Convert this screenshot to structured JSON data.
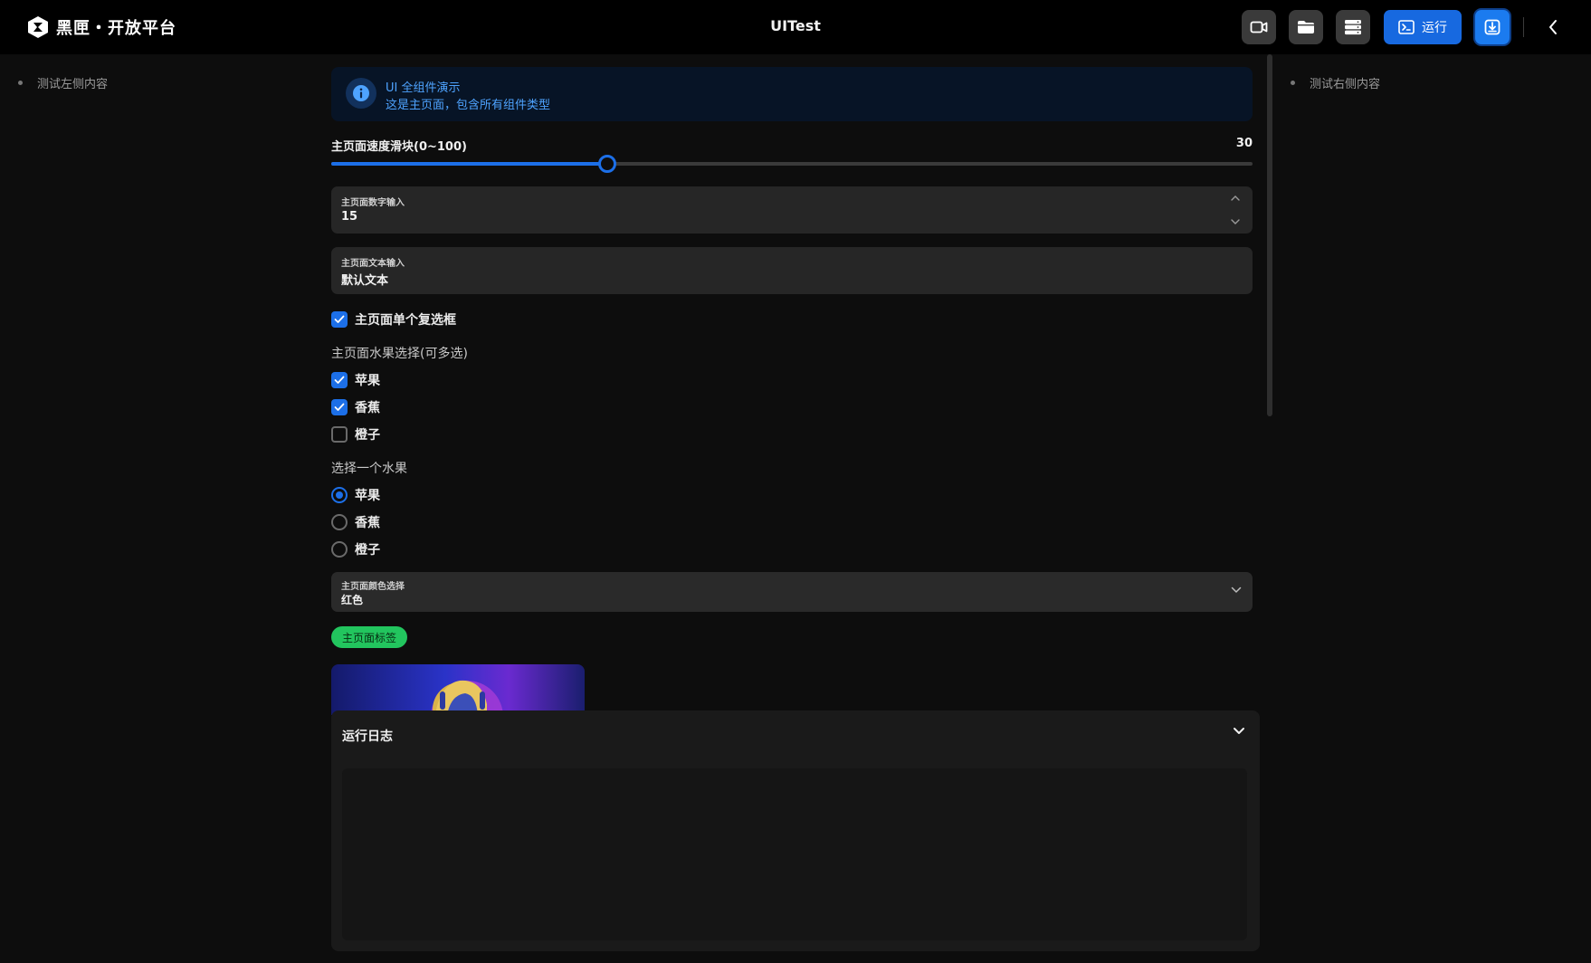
{
  "app": {
    "brand": "黑匣・开放平台",
    "title": "UITest"
  },
  "toolbar": {
    "run_label": "运行"
  },
  "left_panel": {
    "item": "测试左侧内容"
  },
  "right_panel": {
    "item": "测试右侧内容"
  },
  "alert": {
    "title": "UI 全组件演示",
    "description": "这是主页面，包含所有组件类型"
  },
  "slider": {
    "label": "主页面速度滑块(0~100)",
    "value": "30",
    "fraction": 0.3
  },
  "number_input": {
    "label": "主页面数字输入",
    "value": "15"
  },
  "text_input": {
    "label": "主页面文本输入",
    "value": "默认文本"
  },
  "single_checkbox": {
    "label": "主页面单个复选框",
    "checked": true
  },
  "fruit_checkboxes": {
    "title": "主页面水果选择(可多选)",
    "options": [
      {
        "label": "苹果",
        "checked": true
      },
      {
        "label": "香蕉",
        "checked": true
      },
      {
        "label": "橙子",
        "checked": false
      }
    ]
  },
  "fruit_radio": {
    "title": "选择一个水果",
    "options": [
      {
        "label": "苹果",
        "selected": true
      },
      {
        "label": "香蕉",
        "selected": false
      },
      {
        "label": "橙子",
        "selected": false
      }
    ]
  },
  "color_select": {
    "label": "主页面颜色选择",
    "value": "红色"
  },
  "tag": {
    "label": "主页面标签",
    "color": "#22c55e"
  },
  "log_panel": {
    "title": "运行日志"
  },
  "colors": {
    "accent": "#1c6fe8",
    "background": "#0d0d0d"
  }
}
